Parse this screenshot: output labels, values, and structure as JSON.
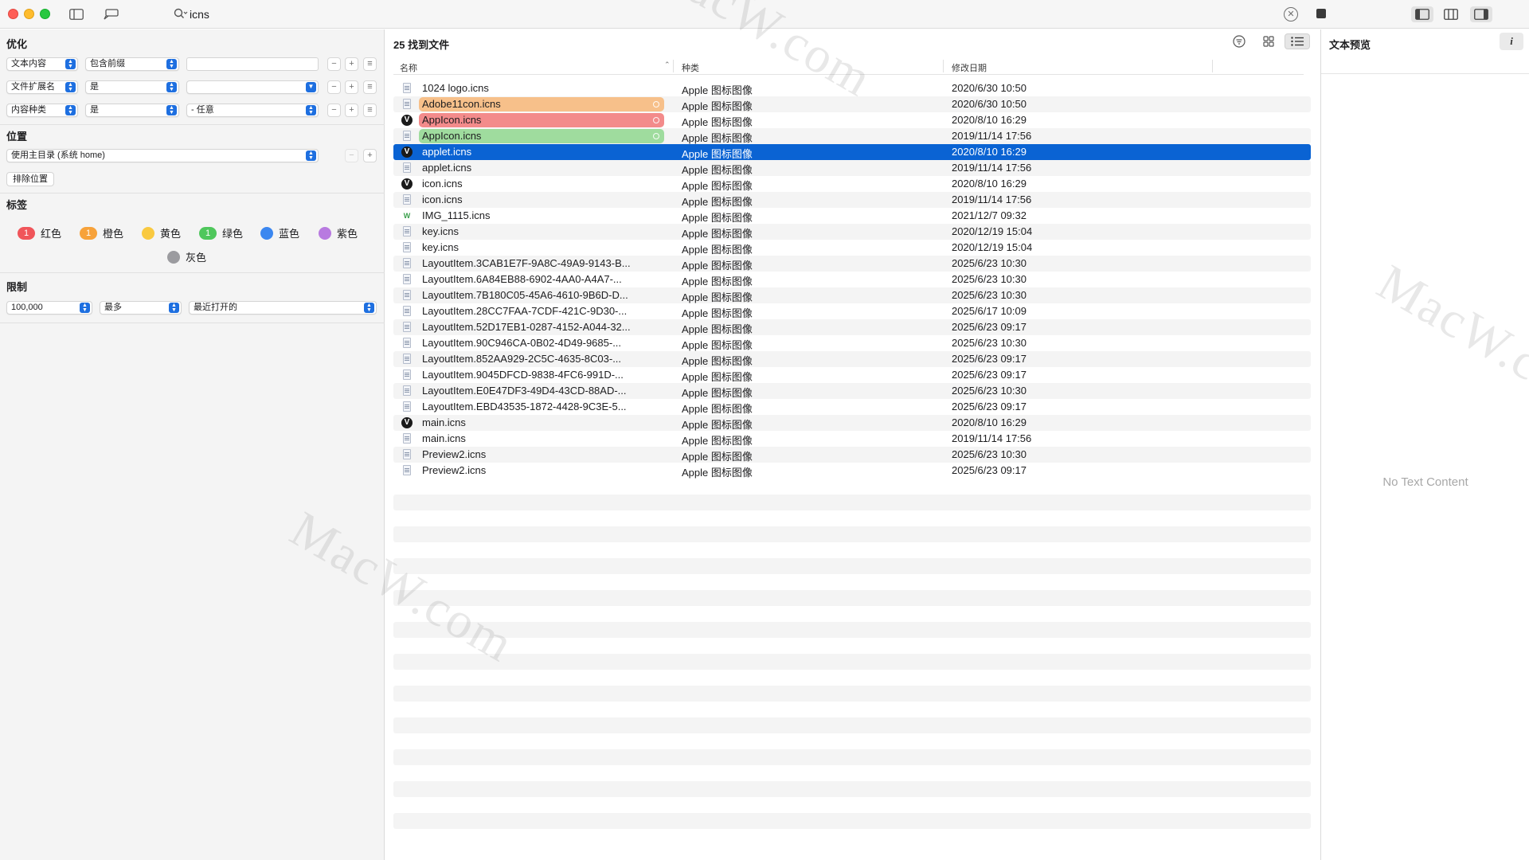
{
  "search": {
    "query": "icns"
  },
  "left": {
    "optimize_title": "优化",
    "criteria": [
      {
        "attr": "文本内容",
        "op": "包含前缀",
        "value": ""
      },
      {
        "attr": "文件扩展名",
        "op": "是",
        "value": ""
      },
      {
        "attr": "内容种类",
        "op": "是",
        "value": "- 任意"
      }
    ],
    "location_title": "位置",
    "location_value": "使用主目录 (系统 home)",
    "exclude_button": "排除位置",
    "tags_title": "标签",
    "tags": [
      {
        "label": "红色",
        "count": "1",
        "color": "#f0555a"
      },
      {
        "label": "橙色",
        "count": "1",
        "color": "#f7a23a"
      },
      {
        "label": "黄色",
        "count": "",
        "color": "#f9c940"
      },
      {
        "label": "绿色",
        "count": "1",
        "color": "#4fc75c"
      },
      {
        "label": "蓝色",
        "count": "",
        "color": "#3b87f0"
      },
      {
        "label": "紫色",
        "count": "",
        "color": "#b87ae0"
      },
      {
        "label": "灰色",
        "count": "",
        "color": "#9b9b9f"
      }
    ],
    "limit_title": "限制",
    "limit_count": "100,000",
    "limit_mode": "最多",
    "limit_sort": "最近打开的"
  },
  "results": {
    "title": "25 找到文件",
    "columns": {
      "name": "名称",
      "kind": "种类",
      "date": "修改日期"
    },
    "rows": [
      {
        "name": "1024 logo.icns",
        "kind": "Apple 图标图像",
        "date": "2020/6/30 10:50",
        "icon": "doc",
        "tag": ""
      },
      {
        "name": "Adobe11con.icns",
        "kind": "Apple 图标图像",
        "date": "2020/6/30 10:50",
        "icon": "doc",
        "tag": "#f7c08a"
      },
      {
        "name": "AppIcon.icns",
        "kind": "Apple 图标图像",
        "date": "2020/8/10 16:29",
        "icon": "v",
        "tag": "#f38b8b"
      },
      {
        "name": "AppIcon.icns",
        "kind": "Apple 图标图像",
        "date": "2019/11/14 17:56",
        "icon": "doc",
        "tag": "#9fdc9e"
      },
      {
        "name": "applet.icns",
        "kind": "Apple 图标图像",
        "date": "2020/8/10 16:29",
        "icon": "v",
        "tag": "",
        "selected": true
      },
      {
        "name": "applet.icns",
        "kind": "Apple 图标图像",
        "date": "2019/11/14 17:56",
        "icon": "doc",
        "tag": ""
      },
      {
        "name": "icon.icns",
        "kind": "Apple 图标图像",
        "date": "2020/8/10 16:29",
        "icon": "v",
        "tag": ""
      },
      {
        "name": "icon.icns",
        "kind": "Apple 图标图像",
        "date": "2019/11/14 17:56",
        "icon": "doc",
        "tag": ""
      },
      {
        "name": "IMG_1115.icns",
        "kind": "Apple 图标图像",
        "date": "2021/12/7 09:32",
        "icon": "w",
        "tag": ""
      },
      {
        "name": "key.icns",
        "kind": "Apple 图标图像",
        "date": "2020/12/19 15:04",
        "icon": "doc",
        "tag": ""
      },
      {
        "name": "key.icns",
        "kind": "Apple 图标图像",
        "date": "2020/12/19 15:04",
        "icon": "doc",
        "tag": ""
      },
      {
        "name": "LayoutItem.3CAB1E7F-9A8C-49A9-9143-B...",
        "kind": "Apple 图标图像",
        "date": "2025/6/23 10:30",
        "icon": "doc",
        "tag": ""
      },
      {
        "name": "LayoutItem.6A84EB88-6902-4AA0-A4A7-...",
        "kind": "Apple 图标图像",
        "date": "2025/6/23 10:30",
        "icon": "doc",
        "tag": ""
      },
      {
        "name": "LayoutItem.7B180C05-45A6-4610-9B6D-D...",
        "kind": "Apple 图标图像",
        "date": "2025/6/23 10:30",
        "icon": "doc",
        "tag": ""
      },
      {
        "name": "LayoutItem.28CC7FAA-7CDF-421C-9D30-...",
        "kind": "Apple 图标图像",
        "date": "2025/6/17 10:09",
        "icon": "doc",
        "tag": ""
      },
      {
        "name": "LayoutItem.52D17EB1-0287-4152-A044-32...",
        "kind": "Apple 图标图像",
        "date": "2025/6/23 09:17",
        "icon": "doc",
        "tag": ""
      },
      {
        "name": "LayoutItem.90C946CA-0B02-4D49-9685-...",
        "kind": "Apple 图标图像",
        "date": "2025/6/23 10:30",
        "icon": "doc",
        "tag": ""
      },
      {
        "name": "LayoutItem.852AA929-2C5C-4635-8C03-...",
        "kind": "Apple 图标图像",
        "date": "2025/6/23 09:17",
        "icon": "doc",
        "tag": ""
      },
      {
        "name": "LayoutItem.9045DFCD-9838-4FC6-991D-...",
        "kind": "Apple 图标图像",
        "date": "2025/6/23 09:17",
        "icon": "doc",
        "tag": ""
      },
      {
        "name": "LayoutItem.E0E47DF3-49D4-43CD-88AD-...",
        "kind": "Apple 图标图像",
        "date": "2025/6/23 10:30",
        "icon": "doc",
        "tag": ""
      },
      {
        "name": "LayoutItem.EBD43535-1872-4428-9C3E-5...",
        "kind": "Apple 图标图像",
        "date": "2025/6/23 09:17",
        "icon": "doc",
        "tag": ""
      },
      {
        "name": "main.icns",
        "kind": "Apple 图标图像",
        "date": "2020/8/10 16:29",
        "icon": "v",
        "tag": ""
      },
      {
        "name": "main.icns",
        "kind": "Apple 图标图像",
        "date": "2019/11/14 17:56",
        "icon": "doc",
        "tag": ""
      },
      {
        "name": "Preview2.icns",
        "kind": "Apple 图标图像",
        "date": "2025/6/23 10:30",
        "icon": "doc",
        "tag": ""
      },
      {
        "name": "Preview2.icns",
        "kind": "Apple 图标图像",
        "date": "2025/6/23 09:17",
        "icon": "doc",
        "tag": ""
      }
    ]
  },
  "preview": {
    "title": "文本预览",
    "info_glyph": "i",
    "empty_text": "No Text Content"
  },
  "watermark": "MacW.com",
  "colors": {
    "selection": "#0a63d3",
    "accent": "#1e6fe0"
  }
}
